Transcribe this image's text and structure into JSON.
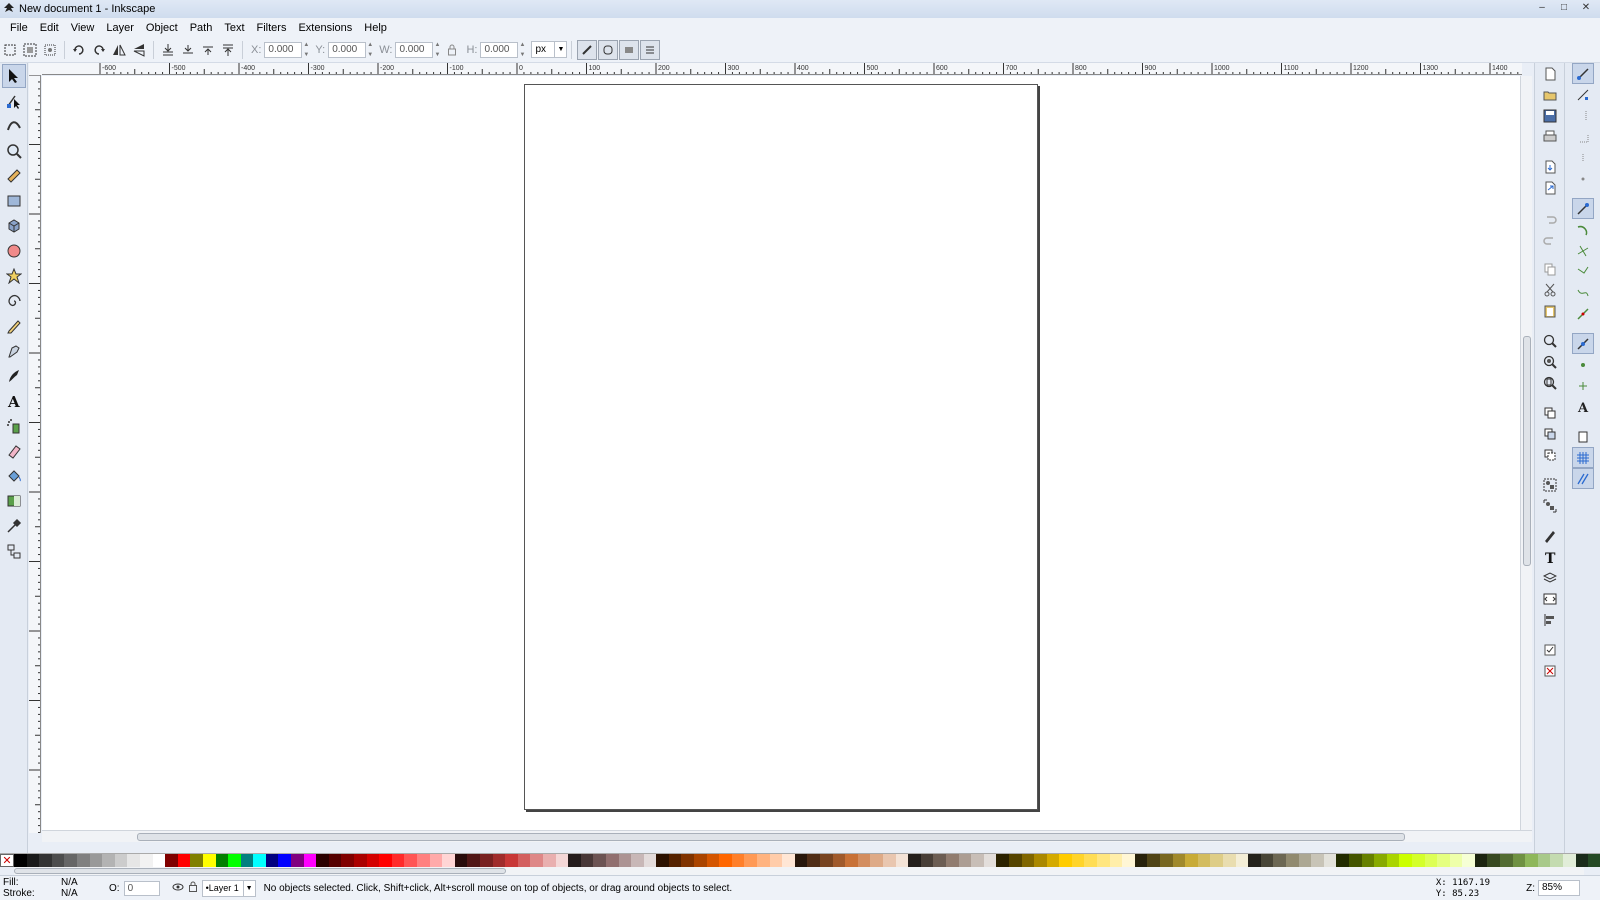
{
  "window": {
    "title": "New document 1 - Inkscape",
    "controls": [
      "–",
      "□",
      "✕"
    ]
  },
  "menu": [
    "File",
    "Edit",
    "View",
    "Layer",
    "Object",
    "Path",
    "Text",
    "Filters",
    "Extensions",
    "Help"
  ],
  "toolcontrols": {
    "x": {
      "label": "X:",
      "value": "0.000"
    },
    "y": {
      "label": "Y:",
      "value": "0.000"
    },
    "w": {
      "label": "W:",
      "value": "0.000"
    },
    "h": {
      "label": "H:",
      "value": "0.000"
    },
    "unit": "px"
  },
  "ruler": {
    "h_labels": [
      "-600",
      "-500",
      "-400",
      "-300",
      "-200",
      "-100",
      "0",
      "100",
      "200",
      "300",
      "400",
      "500",
      "600",
      "700",
      "800",
      "900",
      "1000",
      "1100",
      "1200",
      "1300",
      "1400"
    ]
  },
  "palette": {
    "none_symbol": "✕",
    "colors": [
      "#000000",
      "#1a1a1a",
      "#333333",
      "#4d4d4d",
      "#666666",
      "#808080",
      "#999999",
      "#b3b3b3",
      "#cccccc",
      "#e6e6e6",
      "#f2f2f2",
      "#ffffff",
      "#800000",
      "#ff0000",
      "#808000",
      "#ffff00",
      "#008000",
      "#00ff00",
      "#008080",
      "#00ffff",
      "#000080",
      "#0000ff",
      "#800080",
      "#ff00ff",
      "#2b0000",
      "#550000",
      "#800000",
      "#aa0000",
      "#d40000",
      "#ff0000",
      "#ff2a2a",
      "#ff5555",
      "#ff8080",
      "#ffaaaa",
      "#ffd5d5",
      "#280b0b",
      "#501616",
      "#782121",
      "#a02c2c",
      "#c83737",
      "#d35f5f",
      "#de8787",
      "#e9afaf",
      "#f4d7d7",
      "#241c1c",
      "#483737",
      "#6c5353",
      "#916f6f",
      "#ac9393",
      "#c8b7b7",
      "#e3dbdb",
      "#2b1100",
      "#552200",
      "#803300",
      "#aa4400",
      "#d45500",
      "#ff6600",
      "#ff7f2a",
      "#ff9955",
      "#ffb380",
      "#ffccaa",
      "#ffe6d5",
      "#28170b",
      "#502d16",
      "#784421",
      "#a05a2c",
      "#c87137",
      "#d38d5f",
      "#deaa87",
      "#e9c6af",
      "#f4e3d7",
      "#241f1c",
      "#483e37",
      "#6c5d53",
      "#917c6f",
      "#ac9d93",
      "#c8beb7",
      "#e3dedb",
      "#2b2200",
      "#554400",
      "#806600",
      "#aa8800",
      "#d4aa00",
      "#ffcc00",
      "#ffd42a",
      "#ffdd55",
      "#ffe680",
      "#ffeeaa",
      "#fff6d5",
      "#28220b",
      "#504416",
      "#786721",
      "#a0892c",
      "#c8ab37",
      "#d3bc5f",
      "#decd87",
      "#e9ddaf",
      "#f4eed7",
      "#24221c",
      "#484537",
      "#6c6753",
      "#918a6f",
      "#aca793",
      "#c8c4b7",
      "#e3e2db",
      "#222b00",
      "#445500",
      "#668000",
      "#88aa00",
      "#aad400",
      "#ccff00",
      "#d4ff2a",
      "#ddff55",
      "#e5ff80",
      "#eeffaa",
      "#f6ffd5",
      "#1c2410",
      "#374821",
      "#536c32",
      "#6f9142",
      "#8eb75a",
      "#a8c98a",
      "#c4dbb0",
      "#e1edd8",
      "#1a2b1a",
      "#254a25"
    ]
  },
  "status": {
    "fill_label": "Fill:",
    "fill_value": "N/A",
    "stroke_label": "Stroke:",
    "stroke_value": "N/A",
    "opacity_label": "O:",
    "opacity_value": "0",
    "layer": "•Layer 1",
    "message": "No objects selected. Click, Shift+click, Alt+scroll mouse on top of objects, or drag around objects to select.",
    "x_coord": "X: 1167.19",
    "y_coord": "Y:   85.23",
    "zoom_label": "Z:",
    "zoom_value": "85%"
  }
}
